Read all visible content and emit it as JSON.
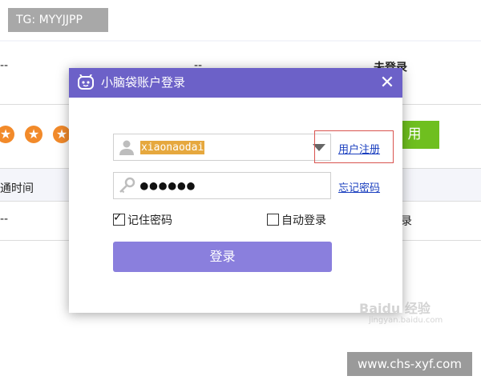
{
  "background": {
    "row1": {
      "col1": "--",
      "col2": "--",
      "col3": "未登录"
    },
    "section_label": "通时间",
    "row2": {
      "col1": "--",
      "col3": "录"
    },
    "action_button_label": "用",
    "star_count": 3
  },
  "dialog": {
    "title": "小脑袋账户登录",
    "close_label": "✕",
    "username_value": "xiaonaodai",
    "password_value": "●●●●●●",
    "register_link": "用户注册",
    "forgot_link": "忘记密码",
    "remember_label": "记住密码",
    "remember_checked": true,
    "auto_login_label": "自动登录",
    "auto_login_checked": false,
    "login_button": "登录",
    "accent_color": "#6c61c8",
    "button_color": "#8a7fdd"
  },
  "overlays": {
    "tg_badge": "TG: MYYJJPP",
    "site_badge": "www.chs-xyf.com",
    "watermark": "Baidu 经验",
    "watermark_sub": "jingyan.baidu.com"
  }
}
